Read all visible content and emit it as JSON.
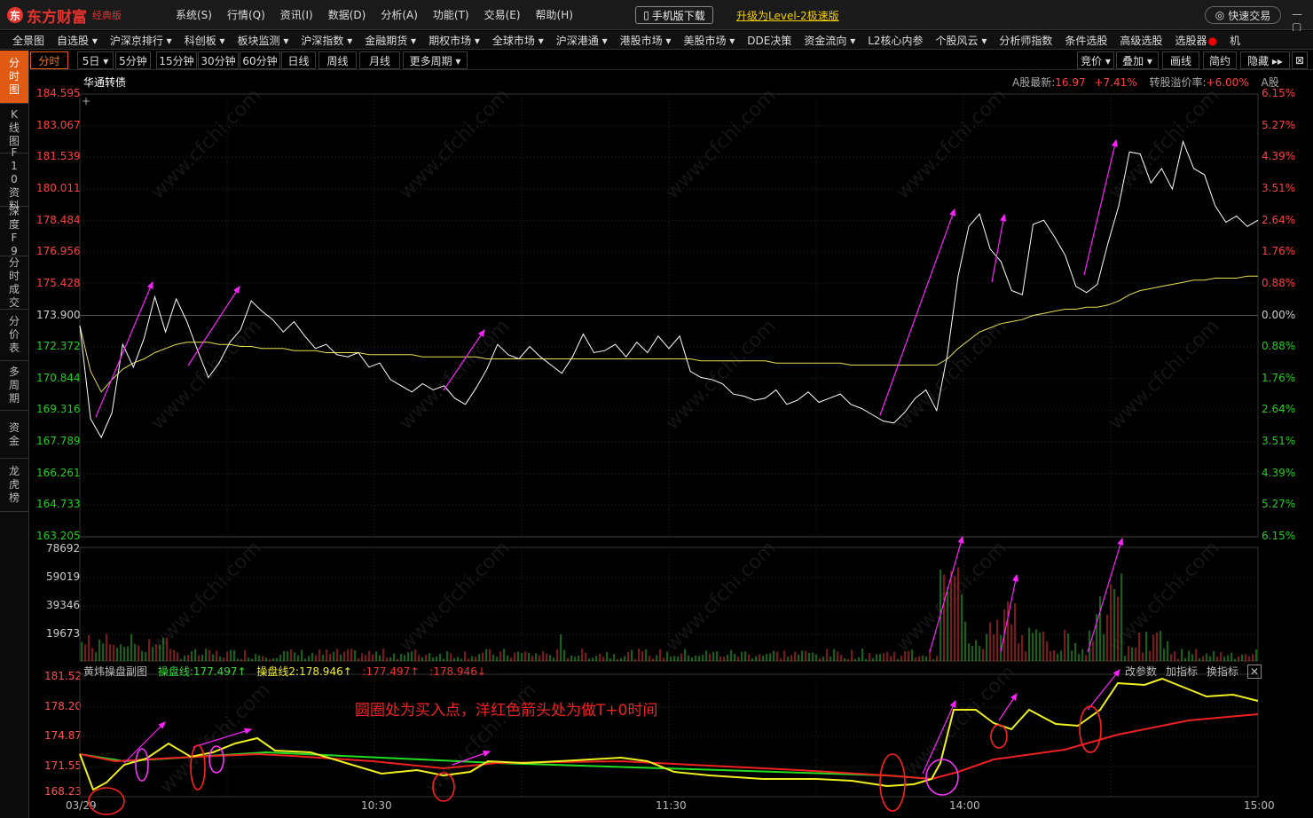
{
  "app": {
    "logo_mark": "东",
    "logo_text": "东方财富",
    "edition": "经典版",
    "mobile_download": "手机版下载",
    "upgrade": "升级为Level-2极速版",
    "quick_trade": "快速交易",
    "window_controls": "— ▢ ✕"
  },
  "main_menu": [
    "系统(S)",
    "行情(Q)",
    "资讯(I)",
    "数据(D)",
    "分析(A)",
    "功能(T)",
    "交易(E)",
    "帮助(H)"
  ],
  "nav": [
    "全景图",
    "自选股 ▾",
    "沪深京排行 ▾",
    "科创板 ▾",
    "板块监测 ▾",
    "沪深指数 ▾",
    "金融期货 ▾",
    "期权市场 ▾",
    "全球市场 ▾",
    "沪深港通 ▾",
    "港股市场 ▾",
    "美股市场 ▾",
    "DDE决策",
    "资金流向 ▾",
    "L2核心内参",
    "个股风云 ▾",
    "分析师指数",
    "条件选股",
    "高级选股",
    "选股器",
    "机"
  ],
  "sidebar": [
    "分时图",
    "K线图",
    "F10资料",
    "深度F9",
    "分时成交",
    "分价表",
    "多周期",
    "资金",
    "龙虎榜"
  ],
  "periods": [
    "分时",
    "5日 ▾",
    "5分钟",
    "15分钟",
    "30分钟",
    "60分钟",
    "日线",
    "周线",
    "月线",
    "更多周期 ▾"
  ],
  "right_tools": [
    "竞价 ▾",
    "叠加 ▾",
    "画线",
    "简约",
    "隐藏 ▸▸"
  ],
  "stock": {
    "name": "华通转债",
    "a_share_label": "A股最新:",
    "a_share_price": "16.97",
    "a_share_change": "+7.41%",
    "premium_label": "转股溢价率:",
    "premium_value": "+6.00%",
    "a_tag": "A股"
  },
  "price_axis_left": [
    "184.595",
    "183.067",
    "181.539",
    "180.011",
    "178.484",
    "176.956",
    "175.428",
    "173.900",
    "172.372",
    "170.844",
    "169.316",
    "167.789",
    "166.261",
    "164.733",
    "163.205"
  ],
  "price_axis_right": [
    "6.15%",
    "5.27%",
    "4.39%",
    "3.51%",
    "2.64%",
    "1.76%",
    "0.88%",
    "0.00%",
    "0.88%",
    "1.76%",
    "2.64%",
    "3.51%",
    "4.39%",
    "5.27%",
    "6.15%"
  ],
  "volume_axis": [
    "78692",
    "59019",
    "39346",
    "19673"
  ],
  "indicator": {
    "name": "黄炜操盘副图",
    "line1": "操盘线:177.497↑",
    "line2": "操盘线2:178.946↑",
    "v1": ":177.497↑",
    "v2": ":178.946↓",
    "right": [
      "改参数",
      "加指标",
      "换指标",
      "✕"
    ]
  },
  "indicator_axis": [
    "181.52",
    "178.20",
    "174.87",
    "171.55",
    "168.23"
  ],
  "annotation": "圆圈处为买入点，洋红色箭头处为做T+0时间",
  "time_axis": [
    "03/29",
    "10:30",
    "11:30",
    "14:00",
    "15:00"
  ],
  "watermark": "www.cfchi.com",
  "colors": {
    "accent": "#e05a14",
    "price_line": "#ffffff",
    "avg_line": "#e8e050",
    "up": "#ff3030",
    "down": "#22cc22",
    "arrow": "#ff22ff",
    "circle_red": "#ff2020",
    "circle_magenta": "#ff33ff"
  },
  "chart_data": {
    "type": "line",
    "title": "华通转债",
    "series": [
      {
        "values": [
          173.4,
          168.9,
          168.0,
          169.2,
          172.5,
          171.4,
          172.8,
          174.8,
          173.1,
          174.7,
          173.6,
          172.2,
          170.9,
          171.6,
          172.6,
          173.2,
          174.6,
          174.1,
          173.7,
          173.1,
          173.6,
          172.9,
          172.3,
          172.5,
          172.0,
          171.9,
          172.1,
          171.4,
          171.6,
          170.8,
          170.5,
          170.2,
          170.6,
          170.3,
          170.5,
          169.9,
          169.6,
          170.4,
          171.3,
          172.5,
          172.0,
          171.8,
          172.4,
          171.9,
          171.5,
          171.1,
          171.9,
          173.0,
          172.1,
          172.2,
          172.5,
          171.9,
          172.6,
          172.1,
          172.9,
          172.3,
          172.9,
          171.2,
          170.9,
          170.8,
          170.6,
          170.1,
          170.0,
          169.8,
          169.9,
          170.3,
          169.6,
          169.8,
          170.2,
          169.7,
          169.9,
          170.1,
          169.6,
          169.4,
          169.1,
          168.8,
          168.7,
          169.2,
          169.9,
          170.3,
          169.3,
          172.0,
          175.8,
          178.2,
          178.8,
          177.1,
          176.5,
          175.1,
          174.9,
          178.3,
          178.5,
          177.7,
          176.8,
          175.3,
          175.0,
          175.4,
          177.4,
          179.2,
          181.8,
          181.7,
          180.3,
          181.0,
          180.0,
          182.3,
          181.0,
          180.7,
          179.2,
          178.4,
          178.7,
          178.2,
          178.5
        ],
        "color": "#ffffff"
      },
      {
        "values": [
          173.4,
          171.2,
          170.2,
          170.8,
          171.3,
          171.6,
          171.8,
          172.1,
          172.3,
          172.5,
          172.6,
          172.6,
          172.6,
          172.5,
          172.5,
          172.4,
          172.4,
          172.3,
          172.3,
          172.3,
          172.2,
          172.2,
          172.2,
          172.1,
          172.1,
          172.1,
          172.1,
          172.0,
          172.0,
          172.0,
          172.0,
          172.0,
          171.9,
          171.9,
          171.9,
          171.9,
          171.9,
          171.9,
          171.8,
          171.8,
          171.8,
          171.8,
          171.8,
          171.8,
          171.8,
          171.8,
          171.8,
          171.8,
          171.8,
          171.8,
          171.8,
          171.8,
          171.8,
          171.8,
          171.8,
          171.8,
          171.8,
          171.8,
          171.7,
          171.7,
          171.7,
          171.7,
          171.7,
          171.7,
          171.7,
          171.6,
          171.6,
          171.6,
          171.6,
          171.6,
          171.6,
          171.6,
          171.5,
          171.5,
          171.5,
          171.5,
          171.5,
          171.5,
          171.5,
          171.5,
          171.5,
          171.8,
          172.3,
          172.7,
          173.1,
          173.3,
          173.5,
          173.6,
          173.7,
          173.9,
          174.0,
          174.1,
          174.2,
          174.2,
          174.3,
          174.3,
          174.4,
          174.6,
          174.9,
          175.1,
          175.2,
          175.3,
          175.4,
          175.5,
          175.6,
          175.6,
          175.7,
          175.7,
          175.7,
          175.8,
          175.8
        ],
        "color": "#e8e050"
      }
    ],
    "ylim": [
      163.205,
      184.595
    ],
    "x": [
      "03/29",
      "10:30",
      "11:30",
      "14:00",
      "15:00"
    ]
  }
}
